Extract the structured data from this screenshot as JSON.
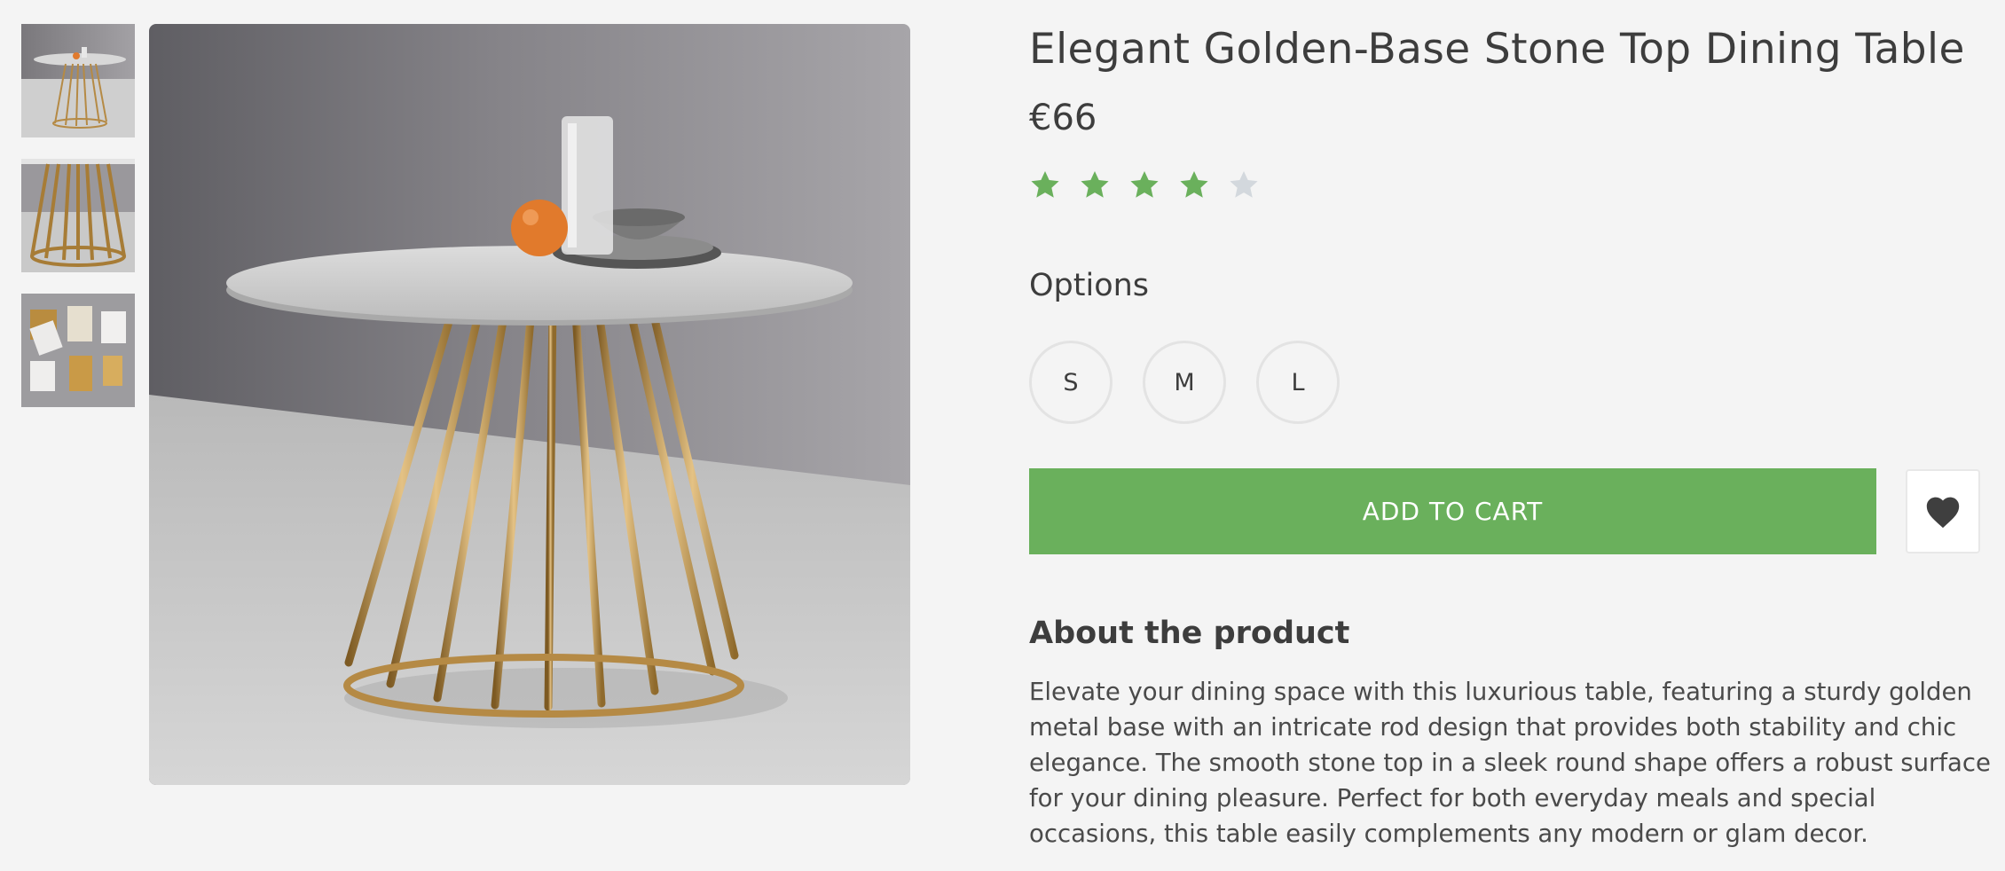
{
  "product": {
    "title": "Elegant Golden-Base Stone Top Dining Table",
    "price": "€66",
    "rating": 4,
    "rating_max": 5
  },
  "gallery": {
    "thumbnails": [
      {
        "icon": "table-thumbnail"
      },
      {
        "icon": "table-base-thumbnail"
      },
      {
        "icon": "material-swatches-thumbnail"
      }
    ],
    "main_icon": "table-main-image"
  },
  "options": {
    "label": "Options",
    "sizes": [
      "S",
      "M",
      "L"
    ]
  },
  "actions": {
    "add_to_cart": "ADD TO CART",
    "wishlist_icon": "heart-icon"
  },
  "about": {
    "heading": "About the product",
    "text": "Elevate your dining space with this luxurious table, featuring a sturdy golden metal base with an intricate rod design that provides both stability and chic elegance. The smooth stone top in a sleek round shape offers a robust surface for your dining pleasure. Perfect for both everyday meals and special occasions, this table easily complements any modern or glam decor."
  },
  "colors": {
    "accent": "#6ab05c",
    "star_filled": "#6ab05c",
    "star_empty": "#d3d8dd",
    "text": "#3d3d3d",
    "background": "#f4f4f4"
  }
}
